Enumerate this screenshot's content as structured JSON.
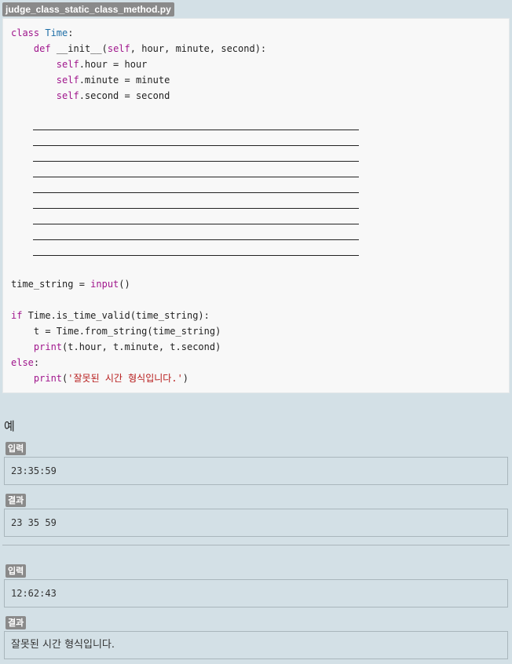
{
  "filename": "judge_class_static_class_method.py",
  "code": {
    "line1_kw": "class",
    "line1_name": "Time",
    "line1_rest": ":",
    "line2_kw": "def",
    "line2_rest": "__init__(",
    "line2_self": "self",
    "line2_tail": ", hour, minute, second):",
    "line3_self": "self",
    "line3_rest": ".hour = hour",
    "line4_self": "self",
    "line4_rest": ".minute = minute",
    "line5_self": "self",
    "line5_rest": ".second = second",
    "line6_pre": "time_string = ",
    "line6_fn": "input",
    "line6_post": "()",
    "line7_kw": "if",
    "line7_rest": " Time.is_time_valid(time_string):",
    "line8": "t = Time.from_string(time_string)",
    "line9_fn": "print",
    "line9_rest": "(t.hour, t.minute, t.second)",
    "line10_kw": "else",
    "line10_rest": ":",
    "line11_fn": "print",
    "line11_open": "(",
    "line11_str": "'잘못된 시간 형식입니다.'",
    "line11_close": ")"
  },
  "example": {
    "title": "예",
    "cases": [
      {
        "input_label": "입력",
        "input": "23:35:59",
        "output_label": "결과",
        "output": "23 35 59"
      },
      {
        "input_label": "입력",
        "input": "12:62:43",
        "output_label": "결과",
        "output": "잘못된 시간 형식입니다."
      }
    ]
  },
  "colors": {
    "background": "#d3e0e6",
    "code_background": "#f8f8f8",
    "keyword": "#a0168c",
    "string": "#b71c1c",
    "label": "#8a8a8a"
  }
}
